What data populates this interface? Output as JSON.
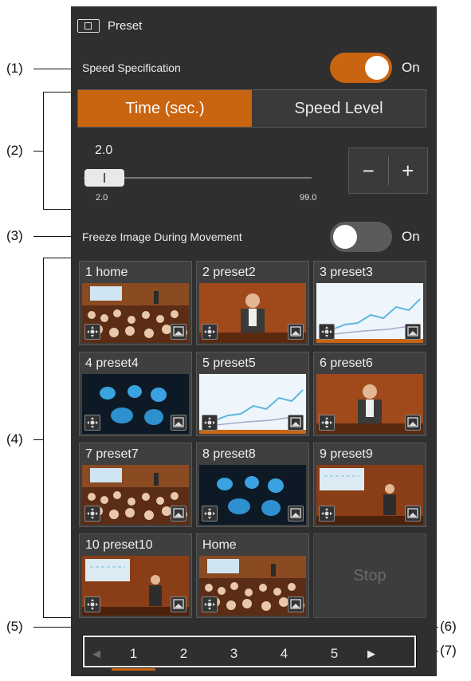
{
  "header": {
    "title": "Preset",
    "icon": "preset-window-icon"
  },
  "speed_spec": {
    "label": "Speed Specification",
    "state": "On",
    "enabled": true
  },
  "mode": {
    "options": [
      "Time (sec.)",
      "Speed Level"
    ],
    "selected": "Time (sec.)"
  },
  "slider": {
    "value": "2.0",
    "min": "2.0",
    "max": "99.0",
    "minus": "−",
    "plus": "+"
  },
  "freeze": {
    "label": "Freeze Image During Movement",
    "state": "On",
    "enabled": false
  },
  "presets": [
    {
      "label": "1 home",
      "scene": "audience"
    },
    {
      "label": "2 preset2",
      "scene": "speaker"
    },
    {
      "label": "3 preset3",
      "scene": "chart"
    },
    {
      "label": "4 preset4",
      "scene": "ultrasound"
    },
    {
      "label": "5 preset5",
      "scene": "chart"
    },
    {
      "label": "6 preset6",
      "scene": "speaker"
    },
    {
      "label": "7 preset7",
      "scene": "audience"
    },
    {
      "label": "8 preset8",
      "scene": "ultrasound"
    },
    {
      "label": "9 preset9",
      "scene": "lecture"
    },
    {
      "label": "10 preset10",
      "scene": "lecture"
    },
    {
      "label": "Home",
      "scene": "audience"
    }
  ],
  "stop": {
    "label": "Stop"
  },
  "pagination": {
    "pages": [
      "1",
      "2",
      "3",
      "4",
      "5"
    ],
    "current": "1",
    "prev": "◀",
    "next": "▶"
  },
  "callouts": [
    "(1)",
    "(2)",
    "(3)",
    "(4)",
    "(5)",
    "(6)",
    "(7)"
  ],
  "colors": {
    "accent": "#c96410",
    "panel": "#2f2f2f"
  }
}
